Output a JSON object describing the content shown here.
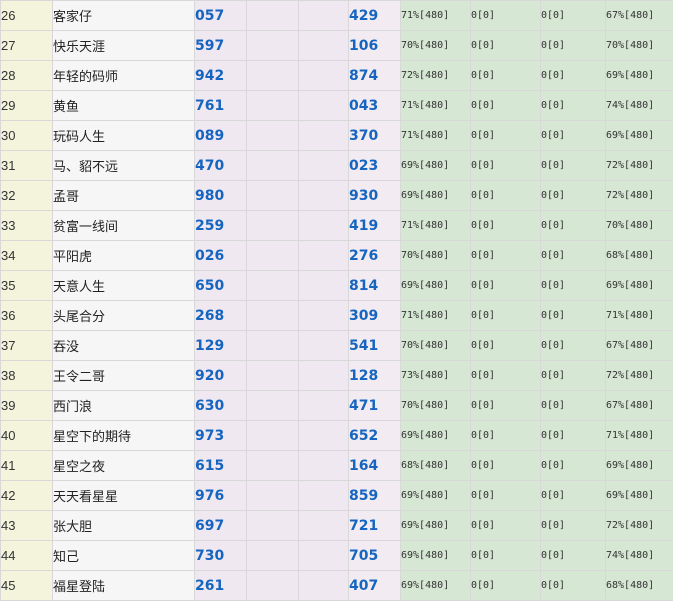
{
  "table": {
    "rows": [
      {
        "rank": "26",
        "name": "客家仔",
        "a": "057",
        "b": "429",
        "p1": "71%[480]",
        "z1": "0[0]",
        "z2": "0[0]",
        "p2": "67%[480]"
      },
      {
        "rank": "27",
        "name": "快乐天涯",
        "a": "597",
        "b": "106",
        "p1": "70%[480]",
        "z1": "0[0]",
        "z2": "0[0]",
        "p2": "70%[480]"
      },
      {
        "rank": "28",
        "name": "年轻的码师",
        "a": "942",
        "b": "874",
        "p1": "72%[480]",
        "z1": "0[0]",
        "z2": "0[0]",
        "p2": "69%[480]"
      },
      {
        "rank": "29",
        "name": "黄鱼",
        "a": "761",
        "b": "043",
        "p1": "71%[480]",
        "z1": "0[0]",
        "z2": "0[0]",
        "p2": "74%[480]"
      },
      {
        "rank": "30",
        "name": "玩码人生",
        "a": "089",
        "b": "370",
        "p1": "71%[480]",
        "z1": "0[0]",
        "z2": "0[0]",
        "p2": "69%[480]"
      },
      {
        "rank": "31",
        "name": "马、貂不远",
        "a": "470",
        "b": "023",
        "p1": "69%[480]",
        "z1": "0[0]",
        "z2": "0[0]",
        "p2": "72%[480]"
      },
      {
        "rank": "32",
        "name": "孟哥",
        "a": "980",
        "b": "930",
        "p1": "69%[480]",
        "z1": "0[0]",
        "z2": "0[0]",
        "p2": "72%[480]"
      },
      {
        "rank": "33",
        "name": "贫富一线间",
        "a": "259",
        "b": "419",
        "p1": "71%[480]",
        "z1": "0[0]",
        "z2": "0[0]",
        "p2": "70%[480]"
      },
      {
        "rank": "34",
        "name": "平阳虎",
        "a": "026",
        "b": "276",
        "p1": "70%[480]",
        "z1": "0[0]",
        "z2": "0[0]",
        "p2": "68%[480]"
      },
      {
        "rank": "35",
        "name": "天意人生",
        "a": "650",
        "b": "814",
        "p1": "69%[480]",
        "z1": "0[0]",
        "z2": "0[0]",
        "p2": "69%[480]"
      },
      {
        "rank": "36",
        "name": "头尾合分",
        "a": "268",
        "b": "309",
        "p1": "71%[480]",
        "z1": "0[0]",
        "z2": "0[0]",
        "p2": "71%[480]"
      },
      {
        "rank": "37",
        "name": "吞没",
        "a": "129",
        "b": "541",
        "p1": "70%[480]",
        "z1": "0[0]",
        "z2": "0[0]",
        "p2": "67%[480]"
      },
      {
        "rank": "38",
        "name": "王令二哥",
        "a": "920",
        "b": "128",
        "p1": "73%[480]",
        "z1": "0[0]",
        "z2": "0[0]",
        "p2": "72%[480]"
      },
      {
        "rank": "39",
        "name": "西门浪",
        "a": "630",
        "b": "471",
        "p1": "70%[480]",
        "z1": "0[0]",
        "z2": "0[0]",
        "p2": "67%[480]"
      },
      {
        "rank": "40",
        "name": "星空下的期待",
        "a": "973",
        "b": "652",
        "p1": "69%[480]",
        "z1": "0[0]",
        "z2": "0[0]",
        "p2": "71%[480]"
      },
      {
        "rank": "41",
        "name": "星空之夜",
        "a": "615",
        "b": "164",
        "p1": "68%[480]",
        "z1": "0[0]",
        "z2": "0[0]",
        "p2": "69%[480]"
      },
      {
        "rank": "42",
        "name": "天天看星星",
        "a": "976",
        "b": "859",
        "p1": "69%[480]",
        "z1": "0[0]",
        "z2": "0[0]",
        "p2": "69%[480]"
      },
      {
        "rank": "43",
        "name": "张大胆",
        "a": "697",
        "b": "721",
        "p1": "69%[480]",
        "z1": "0[0]",
        "z2": "0[0]",
        "p2": "72%[480]"
      },
      {
        "rank": "44",
        "name": "知己",
        "a": "730",
        "b": "705",
        "p1": "69%[480]",
        "z1": "0[0]",
        "z2": "0[0]",
        "p2": "74%[480]"
      },
      {
        "rank": "45",
        "name": "福星登陆",
        "a": "261",
        "b": "407",
        "p1": "69%[480]",
        "z1": "0[0]",
        "z2": "0[0]",
        "p2": "68%[480]"
      }
    ]
  },
  "colors": {
    "rank_bg": "#f4f4dc",
    "name_bg": "#f6f6f6",
    "number_bg": "#f0e8f0",
    "number_text": "#1565c0",
    "stat_bg": "#d6e7d3"
  }
}
